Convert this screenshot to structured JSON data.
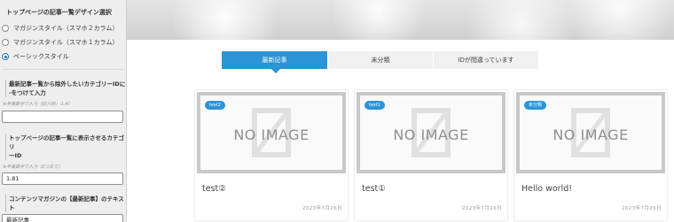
{
  "sidebar": {
    "section_title": "トップページの記事一覧デザイン選択",
    "design_options": [
      {
        "label": "マガジンスタイル（スマホ２カラム）",
        "checked": false
      },
      {
        "label": "マガジンスタイル（スマホ１カラム）",
        "checked": false
      },
      {
        "label": "ベーシックスタイル",
        "checked": true
      }
    ],
    "exclude_label_line1": "最新記事一覧から除外したいカテゴリーIDに",
    "exclude_label_line2": "-をつけて入力",
    "exclude_desc": "※半角数字で入力（記入例：-1,4）",
    "exclude_value": "",
    "show_label_line1": "トップページの記事一覧に表示させるカテゴリ",
    "show_label_line2": "ーID",
    "show_desc": "※半角数字で入力（2つまで）",
    "show_value": "1,81",
    "magazine_label_line1": "コンテンツマガジンの【最新記事】のテキス",
    "magazine_label_line2": "ト",
    "magazine_value": "最新記事"
  },
  "tabs": [
    {
      "label": "最新記事",
      "active": true
    },
    {
      "label": "未分類",
      "active": false
    },
    {
      "label": "IDが間違っています",
      "active": false
    }
  ],
  "no_image_text": "NO IMAGE",
  "cards": [
    {
      "badge": "test2",
      "title": "test②",
      "date": "2023年7月26日"
    },
    {
      "badge": "test1",
      "title": "test①",
      "date": "2023年7月26日"
    },
    {
      "badge": "未分類",
      "title": "Hello world!",
      "date": "2023年7月26日"
    }
  ],
  "colors": {
    "accent": "#2b94d6",
    "tab_inactive": "#f0f0f0",
    "thumb_border": "#c8c8c8"
  }
}
